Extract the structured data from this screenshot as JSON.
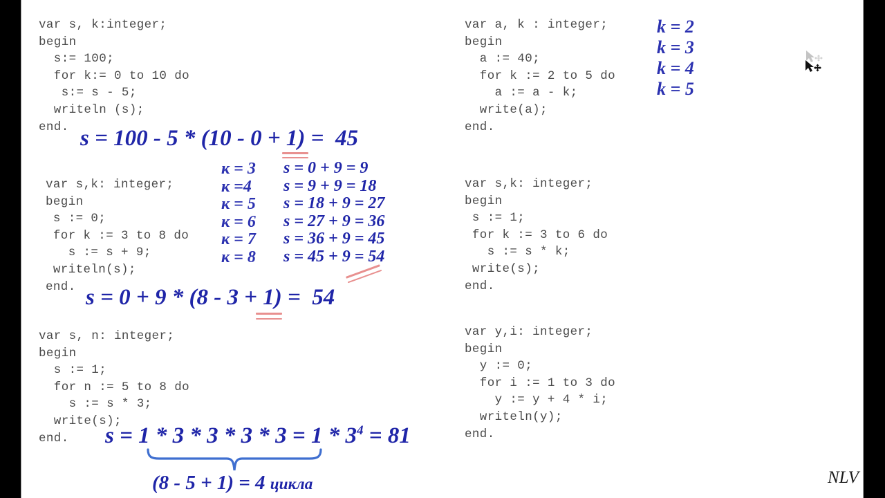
{
  "slide": {
    "signature": "NLV",
    "background_color": "#ffffff",
    "border_color": "#000000",
    "code_color": "#4a4a4a",
    "handwriting_color": "#1f25a8",
    "brace_color": "#3f6fd0",
    "mark_color": "#e8908f"
  },
  "left_column": {
    "block1": {
      "code": "var s, k:integer;\nbegin\n  s:= 100;\n  for k:= 0 to 10 do\n   s:= s - 5;\n  writeln (s);\nend.",
      "formula": "s = 100 - 5 * (10 - 0 + 1) =  45"
    },
    "block2": {
      "code": "var s,k: integer;\nbegin\n s := 0;\n for k := 3 to 8 do\n   s := s + 9;\n writeln(s);\nend.",
      "trace_k": [
        "к = 3",
        "к =4",
        "к = 5",
        "к = 6",
        "к = 7",
        "к = 8"
      ],
      "trace_s": [
        "s = 0 + 9 = 9",
        "s = 9 + 9 = 18",
        "s = 18 + 9 = 27",
        "s = 27 + 9 = 36",
        "s = 36 + 9 = 45",
        "s = 45 + 9 = 54"
      ],
      "formula": "s = 0 + 9 * (8 - 3 + 1) =  54"
    },
    "block3": {
      "code": "var s, n: integer;\nbegin\n  s := 1;\n  for n := 5 to 8 do\n    s := s * 3;\n  write(s);\nend.",
      "formula_main": "s = 1 * 3 * 3 * 3 * 3 = 1 * 3",
      "formula_exponent": "4",
      "formula_tail": " = 81",
      "brace_note": "(8 - 5 + 1) = 4 ",
      "brace_note_word": "цикла"
    }
  },
  "right_column": {
    "block1": {
      "code": "var a, k : integer;\nbegin\n  a := 40;\n  for k := 2 to 5 do\n    a := a - k;\n  write(a);\nend.",
      "trace_k": [
        "k = 2",
        "k = 3",
        "k = 4",
        "k = 5"
      ]
    },
    "block2": {
      "code": "var s,k: integer;\nbegin\n s := 1;\n for k := 3 to 6 do\n   s := s * k;\n write(s);\nend."
    },
    "block3": {
      "code": "var y,i: integer;\nbegin\n  y := 0;\n  for i := 1 to 3 do\n    y := y + 4 * i;\n  writeln(y);\nend."
    }
  },
  "cursor": {
    "type": "move-cursor"
  }
}
